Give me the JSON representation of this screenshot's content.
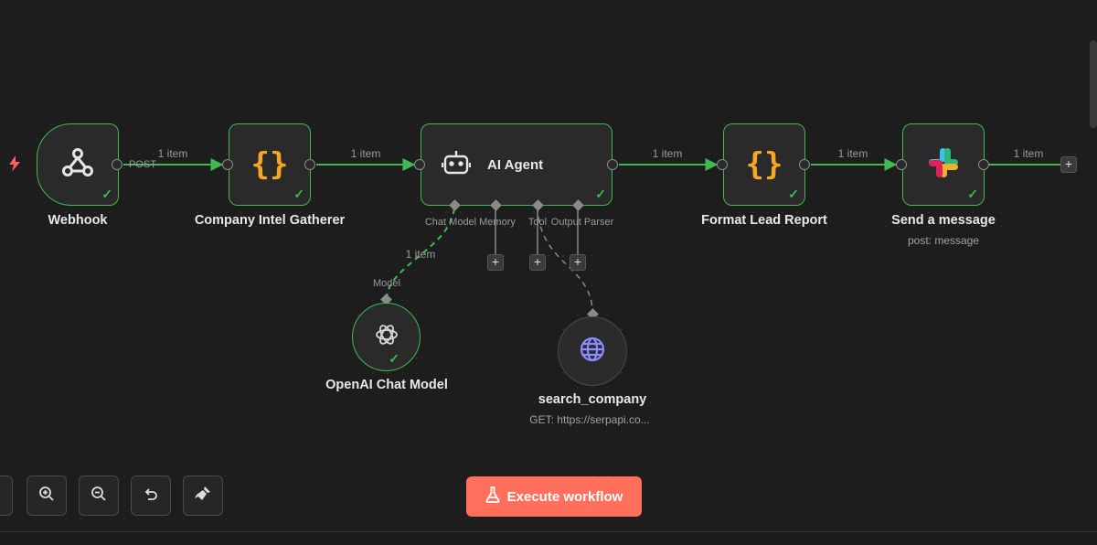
{
  "canvas": {
    "edge_color": "#3fb950",
    "accent_color": "#ff6f5c"
  },
  "nodes": {
    "webhook": {
      "label": "Webhook",
      "port_label": "POST",
      "icon": "webhook-icon"
    },
    "company_intel": {
      "label": "Company Intel Gatherer",
      "icon": "code-braces-icon"
    },
    "ai_agent": {
      "title": "AI Agent",
      "icon": "robot-icon",
      "ports": {
        "chat_model": "Chat Model",
        "memory": "Memory",
        "tool": "Tool",
        "output_parser": "Output Parser"
      }
    },
    "format_lead": {
      "label": "Format Lead Report",
      "icon": "code-braces-icon"
    },
    "send_message": {
      "label": "Send a message",
      "subtitle": "post: message",
      "icon": "slack-icon"
    },
    "openai_model": {
      "label": "OpenAI Chat Model",
      "port_label": "Model",
      "icon": "openai-icon"
    },
    "search_company": {
      "label": "search_company",
      "subtitle": "GET: https://serpapi.co...",
      "icon": "globe-icon"
    }
  },
  "edges": {
    "webhook_to_intel": "1 item",
    "intel_to_agent": "1 item",
    "agent_to_format": "1 item",
    "format_to_send": "1 item",
    "send_out": "1 item",
    "model_to_agent": "1 item"
  },
  "toolbar": {
    "execute_label": "Execute workflow",
    "buttons": [
      "zoom-in-icon",
      "zoom-out-icon",
      "undo-icon",
      "tidy-up-icon"
    ]
  }
}
